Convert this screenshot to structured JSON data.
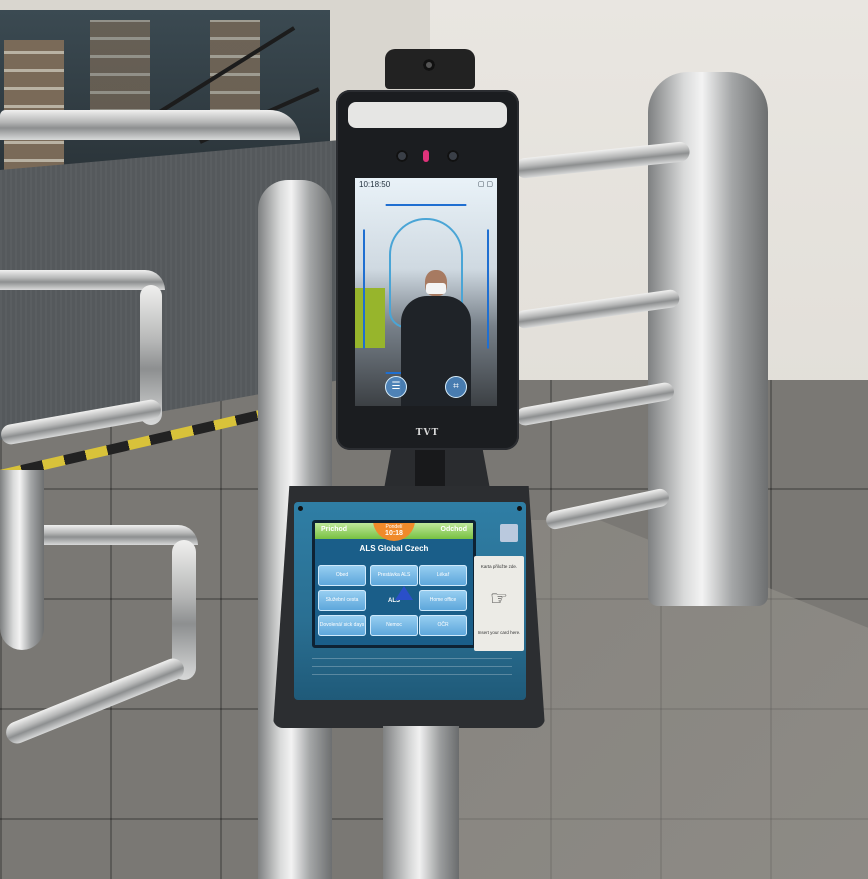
{
  "scene": {
    "face_terminal": {
      "brand": "TVT",
      "screen_clock": "10:18:50",
      "status_icons": "▢ ▢"
    },
    "access_terminal": {
      "tabs": {
        "left": "Prichod",
        "right": "Odchod"
      },
      "time_label": "Pondelí",
      "time_value": "10:18",
      "title": "ALS Global Czech",
      "buttons": [
        "Obed",
        "Prestávka ALS",
        "Lékař",
        "Služební cesta",
        "Home office",
        "Dovolená/ sick days",
        "Nemoc",
        "OČR"
      ],
      "logo_text": "ALS",
      "card_instruction_top": "Karta přiložte zde.",
      "card_instruction_bottom": "Insert your card here."
    },
    "colors": {
      "terminal_body": "#1b1d20",
      "access_face": "#2f7ea5",
      "lcd_topbar": "#78c142",
      "time_bubble": "#f08a2a",
      "stainless": "#b6b7b7"
    }
  }
}
